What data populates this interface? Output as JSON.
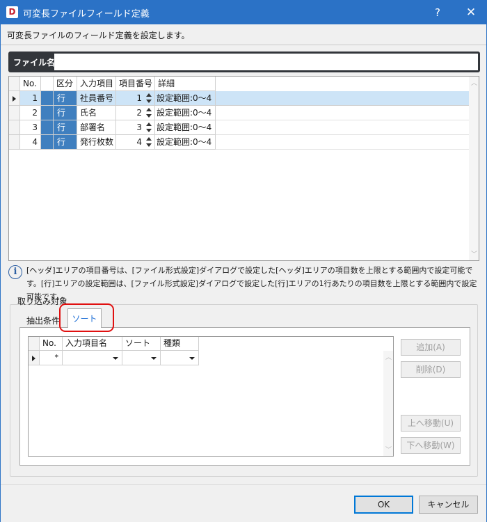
{
  "window": {
    "app_icon_letter": "D",
    "title": "可変長ファイルフィールド定義",
    "help_label": "?",
    "close_label": "✕",
    "description": "可変長ファイルのフィールド定義を設定します。"
  },
  "file_name": {
    "label": "ファイル名:",
    "value": ""
  },
  "field_grid": {
    "headers": {
      "no": "No.",
      "kubun": "区分",
      "input_item": "入力項目",
      "item_number": "項目番号",
      "detail": "詳細"
    },
    "rows": [
      {
        "no": "1",
        "kubun": "行",
        "input_item": "社員番号",
        "item_number": "1",
        "detail": "設定範囲:0～4",
        "selected": true
      },
      {
        "no": "2",
        "kubun": "行",
        "input_item": "氏名",
        "item_number": "2",
        "detail": "設定範囲:0～4"
      },
      {
        "no": "3",
        "kubun": "行",
        "input_item": "部署名",
        "item_number": "3",
        "detail": "設定範囲:0～4"
      },
      {
        "no": "4",
        "kubun": "行",
        "input_item": "発行枚数",
        "item_number": "4",
        "detail": "設定範囲:0～4"
      }
    ],
    "kubun_color": "#3f7fbf",
    "selected_row_color": "#cde4f7"
  },
  "info": {
    "icon": "info-icon",
    "text": "[ヘッダ]エリアの項目番号は、[ファイル形式設定]ダイアログで設定した[ヘッダ]エリアの項目数を上限とする範囲内で設定可能です。[行]エリアの設定範囲は、[ファイル形式設定]ダイアログで設定した[行]エリアの1行あたりの項目数を上限とする範囲内で設定可能です。"
  },
  "import_target": {
    "group_label": "取り込み対象",
    "tabs": [
      {
        "label": "抽出条件",
        "active": false
      },
      {
        "label": "ソート",
        "active": true
      }
    ],
    "highlight_color": "#e01010"
  },
  "sort_grid": {
    "headers": {
      "no": "No.",
      "input_item_name": "入力項目名",
      "sort": "ソート",
      "kind": "種類"
    },
    "new_row": {
      "no": "*"
    }
  },
  "side_buttons": {
    "add": "追加(A)",
    "delete": "削除(D)",
    "move_up": "上へ移動(U)",
    "move_down": "下へ移動(W)"
  },
  "footer": {
    "ok": "OK",
    "cancel": "キャンセル"
  },
  "colors": {
    "titlebar": "#2b72c6",
    "accent": "#0078d7"
  }
}
